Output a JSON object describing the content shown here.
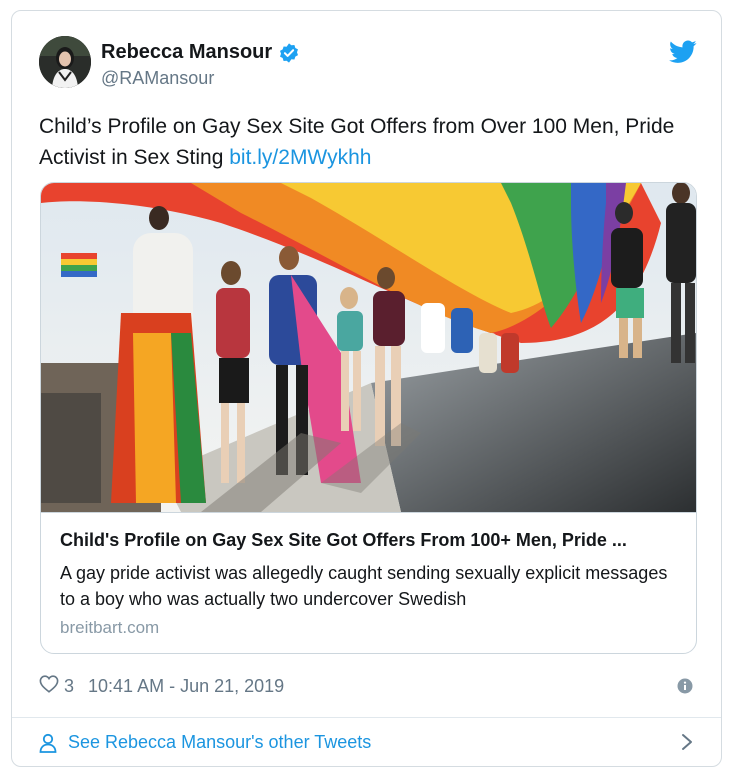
{
  "author": {
    "name": "Rebecca Mansour",
    "handle": "@RAMansour",
    "avatar_icon": "profile-photo",
    "verified_icon": "verified-badge-icon"
  },
  "brand_icon": "twitter-bird-icon",
  "tweet": {
    "text": "Child’s Profile on Gay Sex Site Got Offers from Over 100 Men, Pride Activist in Sex Sting",
    "link_text": "bit.ly/2MWykhh"
  },
  "link_card": {
    "image_description": "pride-parade-rainbow-flag-photo",
    "title": "Child's Profile on Gay Sex Site Got Offers From 100+ Men, Pride ...",
    "description": "A gay pride activist was allegedly caught sending sexually explicit messages to a boy who was actually two undercover Swedish",
    "domain": "breitbart.com"
  },
  "meta": {
    "like_count": "3",
    "timestamp": "10:41 AM - Jun 21, 2019",
    "like_icon": "heart-icon",
    "info_icon": "info-icon"
  },
  "footer": {
    "label": "See Rebecca Mansour's other Tweets",
    "person_icon": "person-icon",
    "chevron_icon": "chevron-right-icon"
  },
  "colors": {
    "link_blue": "#1b95e0",
    "muted_gray": "#657786",
    "border": "#ccd6dd"
  }
}
